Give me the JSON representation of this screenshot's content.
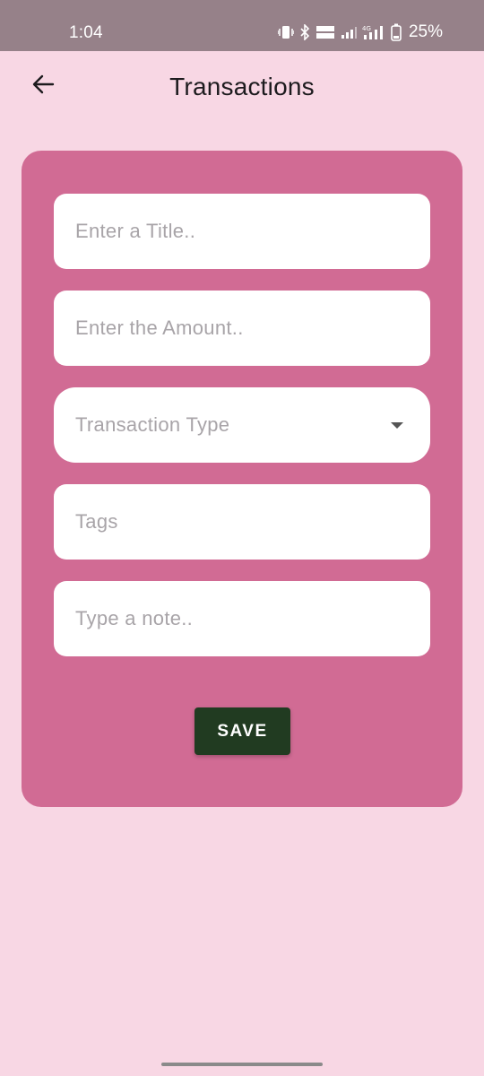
{
  "status_bar": {
    "time": "1:04",
    "battery": "25%",
    "icons": [
      "vibrate-icon",
      "bluetooth-icon",
      "volte-icon",
      "signal-icon",
      "4g-signal-icon",
      "battery-icon"
    ]
  },
  "app_bar": {
    "title": "Transactions",
    "back_icon": "arrow-left-icon"
  },
  "form": {
    "title_placeholder": "Enter a Title..",
    "amount_placeholder": "Enter the Amount..",
    "type_placeholder": "Transaction Type",
    "tags_placeholder": "Tags",
    "note_placeholder": "Type a note..",
    "save_label": "SAVE"
  },
  "colors": {
    "background": "#f8d7e4",
    "status_bar": "#968189",
    "card": "#d16b94",
    "save_button": "#213b21"
  }
}
